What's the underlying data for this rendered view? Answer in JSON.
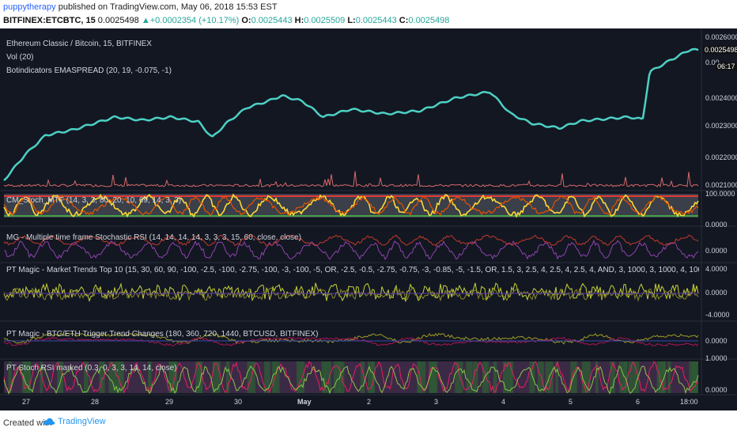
{
  "header": {
    "user": "puppytherapy",
    "published": "published on TradingView.com, May 06, 2018 15:53 EST",
    "symbol": "BITFINEX:ETCBTC, 15",
    "last": "0.0025498",
    "change": "▲+0.0002354 (+10.17%)",
    "o_label": "O:",
    "o_val": "0.0025443",
    "h_label": "H:",
    "h_val": "0.0025509",
    "l_label": "L:",
    "l_val": "0.0025443",
    "c_label": "C:",
    "c_val": "0.0025498"
  },
  "panes": {
    "main": {
      "title": "Ethereum Classic / Bitcoin, 15, BITFINEX",
      "vol": "Vol (20)",
      "indicator": "Botindicators EMASPREAD (20, 19, -0.075, -1)",
      "ticks": [
        "0.0026000",
        "0.0024000",
        "0.0023000",
        "0.0022000",
        "0.0021000"
      ],
      "last_tag": "0.0025498",
      "countdown": "06:17",
      "zero": "0.00"
    },
    "stoch1": {
      "title": "CM_Stoch_MTF (14, 3, 3, 80, 20, 10, 69, 14, 3, 3)",
      "ticks": [
        "100.0000",
        "0.0000"
      ]
    },
    "stoch2": {
      "title": "MG - Multiple time frame Stochastic RSI (14, 14, 14, 14, 3, 3, 3, 15, 60, close, close)",
      "ticks": [
        "0.0000"
      ]
    },
    "trends": {
      "title": "PT Magic - Market Trends Top 10 (15, 30, 60, 90, -100, -2.5, -100, -2.75, -100, -3, -100, -5, OR, -2.5, -0.5, -2.75, -0.75, -3, -0.85, -5, -1.5, OR, 1.5, 3, 2.5, 4, 2.5, 4, 2.5, 4, AND, 3, 1000, 3, 1000, 4, 1000, 4, 1000, AND, 15, 15, 2, ETHBTC+XRPBTC+BCCBTC+EO",
      "ticks": [
        "4.0000",
        "0.0000",
        "-4.0000"
      ]
    },
    "trigger": {
      "title": "PT Magic - BTC/ETH Trigger Trend Changes (180, 360, 720, 1440, BTCUSD, BITFINEX)",
      "ticks": [
        "0.0000"
      ]
    },
    "rsi": {
      "title": "PT Stoch RSI marked (0.3, 0, 3, 3, 14, 14, close)",
      "ticks": [
        "1.0000",
        "0.0000"
      ]
    }
  },
  "xaxis": [
    "27",
    "28",
    "29",
    "30",
    "May",
    "2",
    "3",
    "4",
    "5",
    "6",
    "18:00"
  ],
  "footer": {
    "created": "Created with",
    "brand": "TradingView"
  },
  "colors": {
    "bg": "#131722",
    "ema": "#4dd0c4",
    "up": "#26a69a",
    "accent": "#2962ff"
  }
}
